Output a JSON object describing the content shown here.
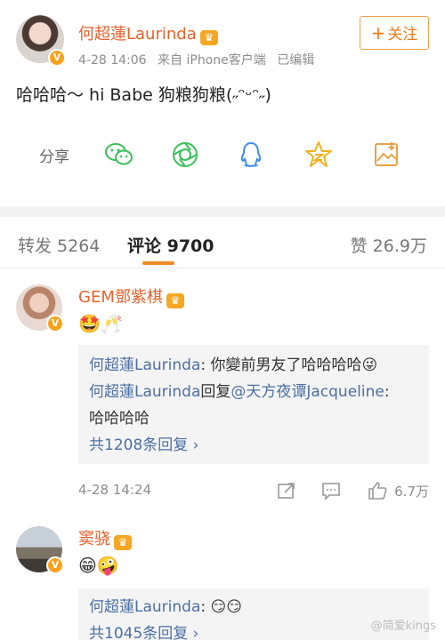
{
  "post": {
    "author": "何超蓮Laurinda",
    "crown_icon": "vip-crown-icon",
    "time": "4-28 14:06",
    "source": "来自 iPhone客户端",
    "edited": "已编辑",
    "follow_label": "关注",
    "follow_plus": "+",
    "text": "哈哈哈～ hi Babe 狗粮狗粮(˶ᵔᵕᵔ˶)",
    "share_label": "分享",
    "share_icons": [
      "wechat-icon",
      "moments-icon",
      "qq-icon",
      "qzone-star-icon",
      "save-image-icon"
    ]
  },
  "tabs": {
    "repost": "转发 5264",
    "comment": "评论 9700",
    "like": "赞 26.9万"
  },
  "comments": [
    {
      "name": "GEM鄧紫棋",
      "emoji": "🤩🥂",
      "replies": [
        {
          "user": "何超蓮Laurinda",
          "sep": ": ",
          "text": "你變前男友了哈哈哈哈😜"
        },
        {
          "user": "何超蓮Laurinda",
          "sep": "回复",
          "mention": "@天方夜谭Jacqueline",
          "text": ":",
          "text2": "哈哈哈哈"
        }
      ],
      "more": "共1208条回复 ›",
      "time": "4-28 14:24",
      "likes": "6.7万"
    },
    {
      "name": "窦骁",
      "emoji": "😁🤪",
      "replies": [
        {
          "user": "何超蓮Laurinda",
          "sep": ": ",
          "text": "😏😏"
        }
      ],
      "more": "共1045条回复 ›"
    }
  ],
  "watermark": "@简爱kings",
  "colors": {
    "accent": "#f08a24",
    "name": "#e8622c",
    "link": "#4c6fa5"
  }
}
